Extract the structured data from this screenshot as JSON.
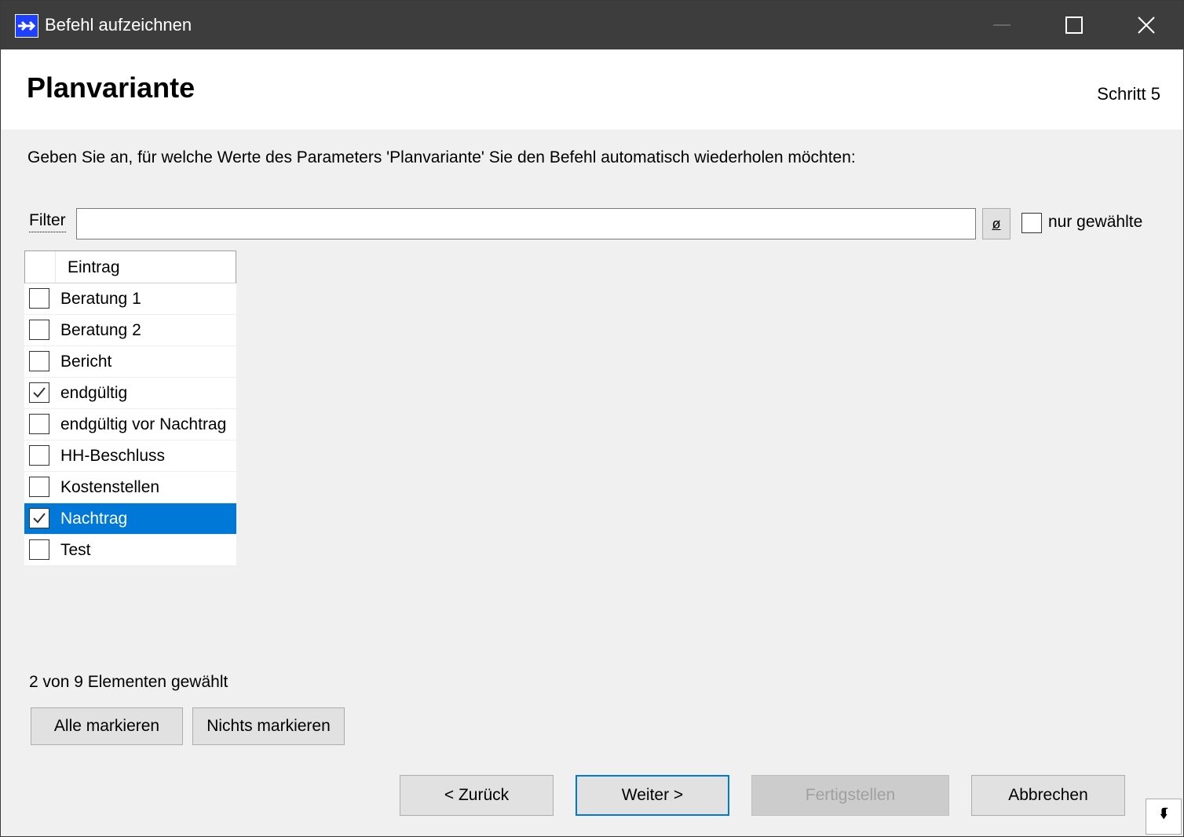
{
  "window": {
    "title": "Befehl aufzeichnen"
  },
  "header": {
    "title": "Planvariante",
    "step": "Schritt 5"
  },
  "instruction": "Geben Sie an, für welche Werte des Parameters 'Planvariante' Sie den Befehl automatisch wiederholen möchten:",
  "filter": {
    "label": "Filter",
    "value": "",
    "clear_label": "ø",
    "only_selected_label": "nur gewählte",
    "only_selected_checked": false
  },
  "list": {
    "column_header": "Eintrag",
    "items": [
      {
        "label": "Beratung 1",
        "checked": false,
        "selected": false
      },
      {
        "label": "Beratung 2",
        "checked": false,
        "selected": false
      },
      {
        "label": "Bericht",
        "checked": false,
        "selected": false
      },
      {
        "label": "endgültig",
        "checked": true,
        "selected": false
      },
      {
        "label": "endgültig vor Nachtrag",
        "checked": false,
        "selected": false
      },
      {
        "label": "HH-Beschluss",
        "checked": false,
        "selected": false
      },
      {
        "label": "Kostenstellen",
        "checked": false,
        "selected": false
      },
      {
        "label": "Nachtrag",
        "checked": true,
        "selected": true
      },
      {
        "label": "Test",
        "checked": false,
        "selected": false
      }
    ]
  },
  "selection_count": "2 von 9 Elementen gewählt",
  "buttons": {
    "select_all": "Alle markieren",
    "select_none": "Nichts markieren",
    "back": "< Zurück",
    "next": "Weiter >",
    "finish": "Fertigstellen",
    "cancel": "Abbrechen"
  },
  "colors": {
    "titlebar": "#3d3d3d",
    "selection": "#0078d7",
    "header_bg": "#ffffff",
    "body_bg": "#f0f0f0"
  },
  "icons": {
    "app": "double-arrow-icon",
    "minimize": "minimize-icon",
    "maximize": "maximize-icon",
    "close": "close-icon",
    "help": "help-corner-icon"
  }
}
